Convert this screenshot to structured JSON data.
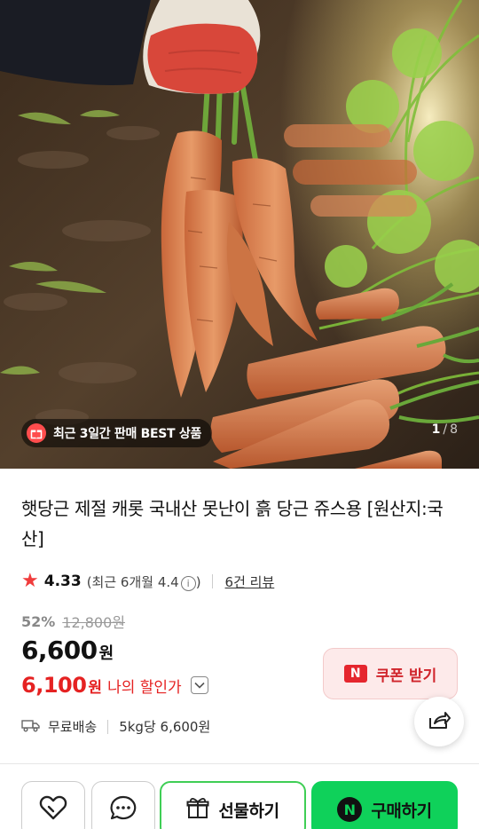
{
  "hero": {
    "badge_text": "최근 3일간 판매 BEST 상품",
    "counter_current": "1",
    "counter_separator": "/",
    "counter_total": "8"
  },
  "product": {
    "title": "햇당근 제절 캐롯 국내산 못난이 흙 당근 쥬스용 [원산지:국산]",
    "rating": "4.33",
    "recent_rating": "(최근 6개월 4.4",
    "recent_rating_close": ")",
    "review_link": "6건 리뷰",
    "discount_rate": "52%",
    "original_price": "12,800원",
    "price": "6,600",
    "price_unit": "원",
    "my_price": "6,100",
    "my_price_unit": "원",
    "my_price_label": "나의 할인가",
    "delivery": "무료배송",
    "unit_price": "5kg당 6,600원"
  },
  "coupon": {
    "badge": "N",
    "label": "쿠폰 받기"
  },
  "bottom_bar": {
    "gift_label": "선물하기",
    "buy_badge": "N",
    "buy_label": "구매하기"
  },
  "colors": {
    "accent_red": "#e52222",
    "naver_green": "#0fd15a",
    "coupon_bg": "#fdeaea"
  },
  "icons": {
    "star": "★",
    "info": "i"
  }
}
